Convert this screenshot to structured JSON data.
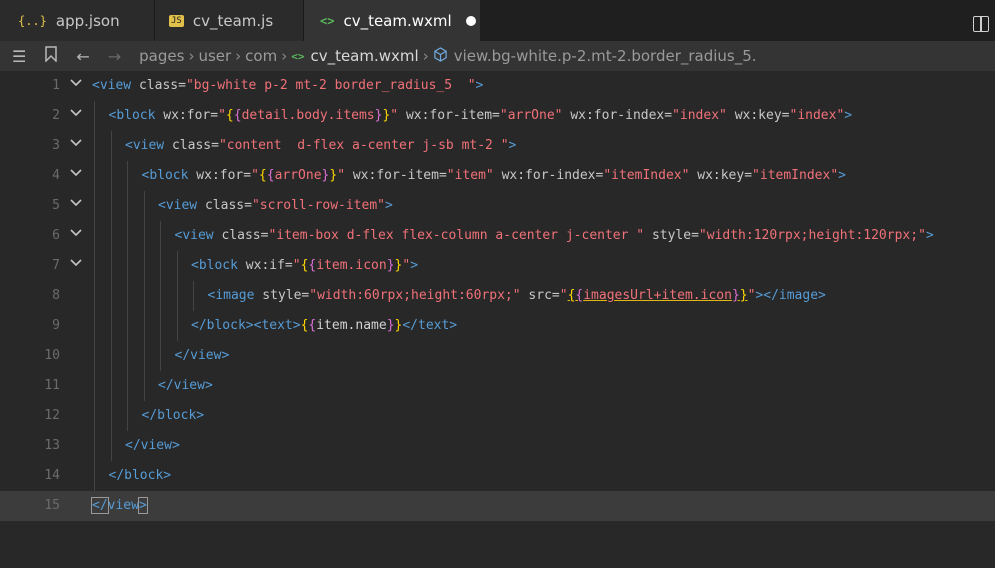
{
  "tabs": [
    {
      "label": "app.json",
      "icon": "{..}"
    },
    {
      "label": "cv_team.js",
      "icon": "JS"
    },
    {
      "label": "cv_team.wxml",
      "icon": "<>"
    }
  ],
  "breadcrumb": {
    "items": [
      "pages",
      "user",
      "com",
      "cv_team.wxml"
    ],
    "symbol": "view.bg-white.p-2.mt-2.border_radius_5."
  },
  "editor": {
    "lines": [
      {
        "n": "1",
        "ind": 0,
        "fold": true,
        "tokens": [
          [
            "t",
            "<view"
          ],
          [
            "a",
            " class="
          ],
          [
            "s",
            "\"bg-white p-2 mt-2 border_radius_5  \""
          ],
          [
            "t",
            ">"
          ]
        ]
      },
      {
        "n": "2",
        "ind": 1,
        "fold": true,
        "tokens": [
          [
            "t",
            "<block"
          ],
          [
            "a",
            " wx:for="
          ],
          [
            "s",
            "\""
          ],
          [
            "b1",
            "{"
          ],
          [
            "b2",
            "{"
          ],
          [
            "s",
            "detail.body.items"
          ],
          [
            "b2",
            "}"
          ],
          [
            "b1",
            "}"
          ],
          [
            "s",
            "\""
          ],
          [
            "a",
            " wx:for-item="
          ],
          [
            "s",
            "\"arrOne\""
          ],
          [
            "a",
            " wx:for-index="
          ],
          [
            "s",
            "\"index\""
          ],
          [
            "a",
            " wx:key="
          ],
          [
            "s",
            "\"index\""
          ],
          [
            "t",
            ">"
          ]
        ]
      },
      {
        "n": "3",
        "ind": 2,
        "fold": true,
        "tokens": [
          [
            "t",
            "<view"
          ],
          [
            "a",
            " class="
          ],
          [
            "s",
            "\"content  d-flex a-center j-sb mt-2 \""
          ],
          [
            "t",
            ">"
          ]
        ]
      },
      {
        "n": "4",
        "ind": 3,
        "fold": true,
        "tokens": [
          [
            "t",
            "<block"
          ],
          [
            "a",
            " wx:for="
          ],
          [
            "s",
            "\""
          ],
          [
            "b1",
            "{"
          ],
          [
            "b2",
            "{"
          ],
          [
            "s",
            "arrOne"
          ],
          [
            "b2",
            "}"
          ],
          [
            "b1",
            "}"
          ],
          [
            "s",
            "\""
          ],
          [
            "a",
            " wx:for-item="
          ],
          [
            "s",
            "\"item\""
          ],
          [
            "a",
            " wx:for-index="
          ],
          [
            "s",
            "\"itemIndex\""
          ],
          [
            "a",
            " wx:key="
          ],
          [
            "s",
            "\"itemIndex\""
          ],
          [
            "t",
            ">"
          ]
        ]
      },
      {
        "n": "5",
        "ind": 4,
        "fold": true,
        "tokens": [
          [
            "t",
            "<view"
          ],
          [
            "a",
            " class="
          ],
          [
            "s",
            "\"scroll-row-item\""
          ],
          [
            "t",
            ">"
          ]
        ]
      },
      {
        "n": "6",
        "ind": 5,
        "fold": true,
        "tokens": [
          [
            "t",
            "<view"
          ],
          [
            "a",
            " class="
          ],
          [
            "s",
            "\"item-box d-flex flex-column a-center j-center \""
          ],
          [
            "a",
            " style="
          ],
          [
            "s",
            "\"width:120rpx;height:120rpx;\""
          ],
          [
            "t",
            ">"
          ]
        ]
      },
      {
        "n": "7",
        "ind": 6,
        "fold": true,
        "tokens": [
          [
            "t",
            "<block"
          ],
          [
            "a",
            " wx:if="
          ],
          [
            "s",
            "\""
          ],
          [
            "b1",
            "{"
          ],
          [
            "b2",
            "{"
          ],
          [
            "s",
            "item.icon"
          ],
          [
            "b2",
            "}"
          ],
          [
            "b1",
            "}"
          ],
          [
            "s",
            "\""
          ],
          [
            "t",
            ">"
          ]
        ]
      },
      {
        "n": "8",
        "ind": 7,
        "fold": false,
        "tokens": [
          [
            "t",
            "<image"
          ],
          [
            "a",
            " style="
          ],
          [
            "s",
            "\"width:60rpx;height:60rpx;\""
          ],
          [
            "a",
            " src="
          ],
          [
            "s",
            "\""
          ],
          [
            "b1 u",
            "{"
          ],
          [
            "b2 u",
            "{"
          ],
          [
            "s u",
            "imagesUrl+item.icon"
          ],
          [
            "b2 u",
            "}"
          ],
          [
            "b1 u",
            "}"
          ],
          [
            "s",
            "\""
          ],
          [
            "t",
            "></image>"
          ]
        ]
      },
      {
        "n": "9",
        "ind": 6,
        "fold": false,
        "tokens": [
          [
            "t",
            "</block><text>"
          ],
          [
            "b1",
            "{"
          ],
          [
            "b2",
            "{"
          ],
          [
            "p",
            "item.name"
          ],
          [
            "b2",
            "}"
          ],
          [
            "b1",
            "}"
          ],
          [
            "t",
            "</text>"
          ]
        ]
      },
      {
        "n": "10",
        "ind": 5,
        "fold": false,
        "tokens": [
          [
            "t",
            "</view>"
          ]
        ]
      },
      {
        "n": "11",
        "ind": 4,
        "fold": false,
        "tokens": [
          [
            "t",
            "</view>"
          ]
        ]
      },
      {
        "n": "12",
        "ind": 3,
        "fold": false,
        "tokens": [
          [
            "t",
            "</block>"
          ]
        ]
      },
      {
        "n": "13",
        "ind": 2,
        "fold": false,
        "tokens": [
          [
            "t",
            "</view>"
          ]
        ]
      },
      {
        "n": "14",
        "ind": 1,
        "fold": false,
        "tokens": [
          [
            "t",
            "</block>"
          ]
        ]
      },
      {
        "n": "15",
        "ind": 0,
        "fold": false,
        "current": true,
        "tokens": [
          [
            "t cursor-box",
            "</"
          ],
          [
            "t",
            "view"
          ],
          [
            "t cursor-box",
            ">"
          ]
        ]
      }
    ]
  },
  "colors": {
    "tag": "#569cd6",
    "attr": "#c8c8c8",
    "string": "#f07178",
    "bracket_gold": "#ffd700",
    "bracket_magenta": "#da70d6"
  }
}
